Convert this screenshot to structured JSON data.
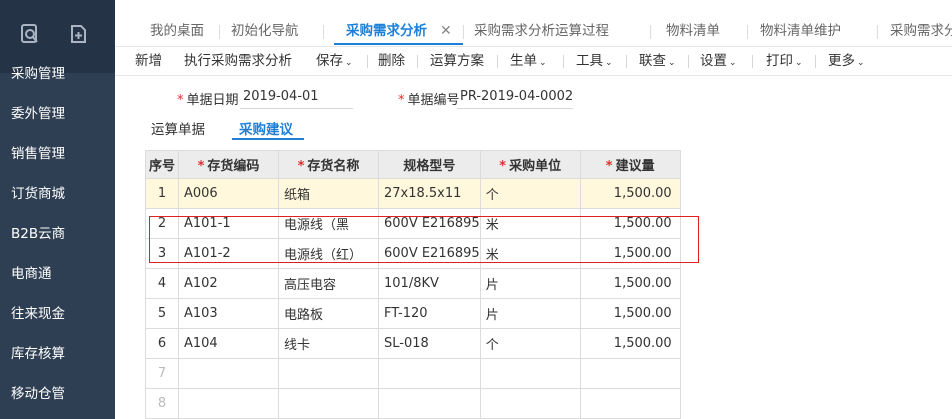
{
  "sidebar": {
    "icons": [
      "search-doc-icon",
      "add-doc-icon"
    ],
    "items": [
      "采购管理",
      "委外管理",
      "销售管理",
      "订货商城",
      "B2B云商",
      "电商通",
      "往来现金",
      "库存核算",
      "移动仓管"
    ]
  },
  "tabs": [
    {
      "label": "我的桌面"
    },
    {
      "label": "初始化导航"
    },
    {
      "label": "采购需求分析",
      "active": true
    },
    {
      "label": "采购需求分析运算过程"
    },
    {
      "label": "物料清单"
    },
    {
      "label": "物料清单维护"
    },
    {
      "label": "采购需求分"
    }
  ],
  "tab_close": "✕",
  "toolbar": {
    "items": [
      {
        "label": "新增"
      },
      {
        "label": "执行采购需求分析"
      },
      {
        "label": "保存",
        "caret": "⌄"
      },
      {
        "label": "删除"
      },
      {
        "label": "运算方案"
      },
      {
        "label": "生单",
        "caret": "⌄"
      },
      {
        "label": "工具",
        "caret": "⌄"
      },
      {
        "label": "联查",
        "caret": "⌄"
      },
      {
        "label": "设置",
        "caret": "⌄"
      },
      {
        "label": "打印",
        "caret": "⌄"
      },
      {
        "label": "更多",
        "caret": "⌄"
      }
    ]
  },
  "form": {
    "date_label": "单据日期",
    "date_value": "2019-04-01",
    "number_label": "单据编号",
    "number_value": "PR-2019-04-0002",
    "required_mark": "*"
  },
  "subtabs": [
    {
      "label": "运算单据"
    },
    {
      "label": "采购建议",
      "active": true
    }
  ],
  "grid": {
    "columns": [
      "序号",
      "存货编码",
      "存货名称",
      "规格型号",
      "采购单位",
      "建议量"
    ],
    "required_columns": [
      false,
      true,
      true,
      false,
      true,
      true
    ],
    "rows": [
      {
        "no": "1",
        "code": "A006",
        "name": "纸箱",
        "spec": "27x18.5x11",
        "unit": "个",
        "qty": "1,500.00",
        "selected": true
      },
      {
        "no": "2",
        "code": "A101-1",
        "name": "电源线（黑",
        "spec": "600V E216895",
        "unit": "米",
        "qty": "1,500.00"
      },
      {
        "no": "3",
        "code": "A101-2",
        "name": "电源线（红）",
        "spec": "600V E216895",
        "unit": "米",
        "qty": "1,500.00"
      },
      {
        "no": "4",
        "code": "A102",
        "name": "高压电容",
        "spec": "101/8KV",
        "unit": "片",
        "qty": "1,500.00"
      },
      {
        "no": "5",
        "code": "A103",
        "name": "电路板",
        "spec": "FT-120",
        "unit": "片",
        "qty": "1,500.00"
      },
      {
        "no": "6",
        "code": "A104",
        "name": "线卡",
        "spec": "SL-018",
        "unit": "个",
        "qty": "1,500.00"
      },
      {
        "no": "7",
        "code": "",
        "name": "",
        "spec": "",
        "unit": "",
        "qty": ""
      },
      {
        "no": "8",
        "code": "",
        "name": "",
        "spec": "",
        "unit": "",
        "qty": ""
      }
    ]
  },
  "colors": {
    "sidebar_bg": "#2f3f53",
    "accent": "#1e7fd8",
    "required": "#e03030",
    "highlight_box": "#e02020",
    "selected_row": "#fff8dc"
  }
}
